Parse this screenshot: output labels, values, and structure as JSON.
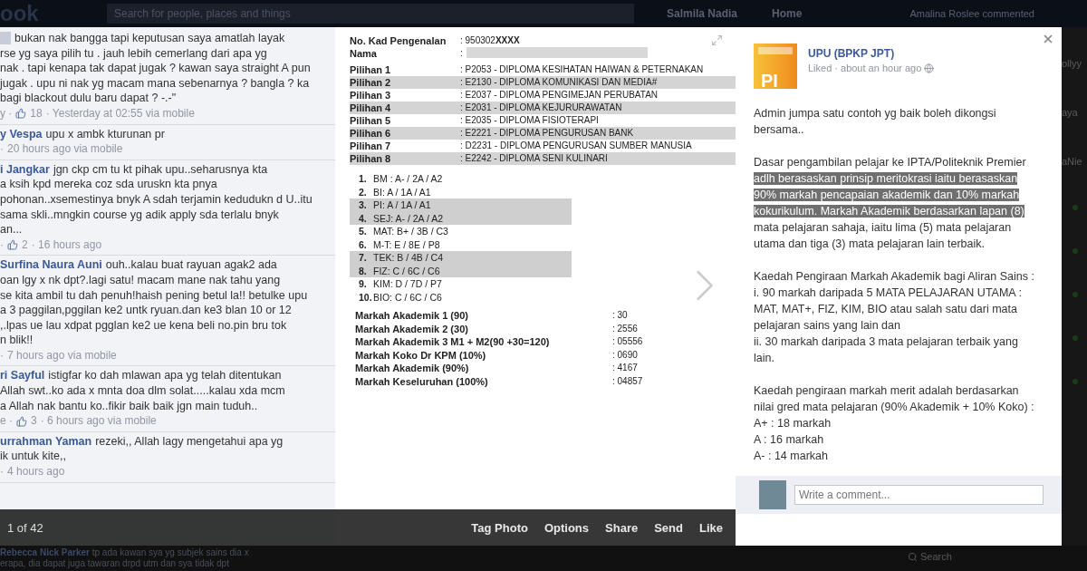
{
  "backdrop": {
    "logo": "ook",
    "search_placeholder": "Search for people, places and things",
    "user": "Salmila Nadia",
    "home": "Home",
    "ticker": "Amalina Roslee commented",
    "side_fragments": [
      "ollyy",
      "aya",
      "aNie"
    ],
    "bottom_comment": {
      "name": "Rebecca Nick Parker",
      "lines": [
        "tp ada kawan sya yg subjek sains dia x",
        "erapa, dia dapat juga tawaran drpd utm dan sya tidak dpt"
      ]
    },
    "chat_search": "Search"
  },
  "photo": {
    "comments": [
      {
        "redacted": true,
        "lines": [
          "bukan nak bangga tapi keputusan saya amatlah layak",
          "rse yg saya pilih tu . jauh lebih cemerlang dari apa yg",
          "nak . tapi kenapa tak dapat jugak ? kawan saya straight A pun",
          "jugak . upu ni nak yg macam mana sebenarnya ? bangla ? ka",
          "bagi blackout dulu baru dapat ? -.-\""
        ],
        "meta": {
          "prefix": "y ·",
          "likes": "18",
          "time": "· Yesterday at 02:55 via mobile"
        }
      },
      {
        "redacted": false,
        "name": "y Vespa",
        "lines": [
          "upu x ambk kturunan pr"
        ],
        "meta": {
          "prefix": "·",
          "time": "20 hours ago via mobile"
        }
      },
      {
        "redacted": false,
        "name": "i Jangkar",
        "lines": [
          "jgn ckp cm tu kt pihak upu..seharusnya kta",
          "a ksih kpd mereka coz sda uruskn kta pnya",
          "pohonan..xsemestinya bnyk A sdah terjamin kedudukn d U..itu",
          "sama skli..mngkin course yg adik apply sda terlalu bnyk",
          "an..."
        ],
        "meta": {
          "prefix": "·",
          "likes": "2",
          "time": "· 16 hours ago"
        }
      },
      {
        "redacted": false,
        "name": "Surfina Naura Auni",
        "lines": [
          "ouh..kalau buat rayuan agak2 ada",
          "oan lgy x nk dpt?.lagi satu! macam mane nak tahu yang",
          "se kita ambil tu dah penuh!haish pening betul la!! betulke upu",
          "a 3 paggilan,pggilan ke2 untk ryuan.dan ke3 blan 10 or 12",
          ",.lpas ue lau xdpat pgglan ke2 ue kena beli no.pin bru tok",
          "n blik!!"
        ],
        "meta": {
          "prefix": "·",
          "time": "7 hours ago via mobile"
        }
      },
      {
        "redacted": false,
        "name": "ri Sayful",
        "lines": [
          "istigfar ko dah mlawan apa yg telah ditentukan",
          "Allah swt..ko ada x mnta doa dlm solat.....kalau xda mcm",
          "a Allah nak bantu ko..fikir baik baik jgn main tuduh.."
        ],
        "meta": {
          "prefix": "e ·",
          "likes": "3",
          "time": "· 6 hours ago via mobile"
        }
      },
      {
        "redacted": false,
        "name": "urrahman Yaman",
        "lines": [
          "rezeki,, Allah lagy mengetahui apa yg",
          "ik untuk kite,,"
        ],
        "meta": {
          "prefix": "·",
          "time": "4 hours ago"
        }
      }
    ],
    "slip": {
      "id": {
        "label": "No. Kad Pengenalan",
        "value": ": 950302**XXXX**"
      },
      "name": {
        "label": "Nama",
        "value": ":",
        "redacted": true
      },
      "choices": [
        {
          "label": "Pilihan 1",
          "value": ": P2053 - DIPLOMA KESIHATAN HAIWAN & PETERNAKAN",
          "shaded": false
        },
        {
          "label": "Pilihan 2",
          "value": ": E2130 - DIPLOMA KOMUNIKASI DAN MEDIA#",
          "shaded": true
        },
        {
          "label": "Pilihan 3",
          "value": ": E2037 - DIPLOMA PENGIMEJAN PERUBATAN",
          "shaded": false
        },
        {
          "label": "Pilihan 4",
          "value": ": E2031 - DIPLOMA KEJURURAWATAN",
          "shaded": true
        },
        {
          "label": "Pilihan 5",
          "value": ": E2035 - DIPLOMA FISIOTERAPI",
          "shaded": false
        },
        {
          "label": "Pilihan 6",
          "value": ": E2221 - DIPLOMA PENGURUSAN BANK",
          "shaded": true
        },
        {
          "label": "Pilihan 7",
          "value": ": D2231 - DIPLOMA PENGURUSAN SUMBER MANUSIA",
          "shaded": false
        },
        {
          "label": "Pilihan 8",
          "value": ": E2242 - DIPLOMA SENI KULINARI",
          "shaded": true
        }
      ],
      "subjects": [
        {
          "num": "1.",
          "text": "BM : A- / 2A / A2",
          "shaded": false
        },
        {
          "num": "2.",
          "text": "BI: A / 1A / A1",
          "shaded": false
        },
        {
          "num": "3.",
          "text": "PI: A / 1A / A1",
          "shaded": true
        },
        {
          "num": "4.",
          "text": "SEJ: A- / 2A / A2",
          "shaded": true
        },
        {
          "num": "5.",
          "text": "MAT: B+ / 3B / C3",
          "shaded": false
        },
        {
          "num": "6.",
          "text": "M-T: E / 8E / P8",
          "shaded": false
        },
        {
          "num": "7.",
          "text": "TEK: B / 4B / C4",
          "shaded": true
        },
        {
          "num": "8.",
          "text": "FIZ: C / 6C / C6",
          "shaded": true
        },
        {
          "num": "9.",
          "text": "KIM: D / 7D / P7",
          "shaded": false
        },
        {
          "num": "10.",
          "text": "BIO: C / 6C / C6",
          "shaded": false
        }
      ],
      "marks": [
        {
          "label": "Markah Akademik 1 (90)",
          "value": ": 30"
        },
        {
          "label": "Markah Akademik 2 (30)",
          "value": ": 2556"
        },
        {
          "label": "Markah Akademik 3 M1 + M2(90 +30=120)",
          "value": ": 05556"
        },
        {
          "label": "Markah Koko Dr KPM (10%)",
          "value": ": 0690"
        },
        {
          "label": "Markah Akademik (90%)",
          "value": ": 4167"
        },
        {
          "label": "Markah Keseluruhan (100%)",
          "value": ": 04857"
        }
      ]
    },
    "counter": "1 of 42",
    "actions": [
      "Tag Photo",
      "Options",
      "Share",
      "Send",
      "Like"
    ]
  },
  "post": {
    "logo_text": "PI",
    "name": "UPU (BPKP JPT)",
    "liked": "Liked",
    "time": "· about an hour ago",
    "paragraphs": [
      {
        "kind": "lines",
        "lines": [
          "Admin jumpa satu contoh yg baik boleh dikongsi bersama.."
        ]
      },
      {
        "kind": "selection",
        "segments": [
          {
            "text": "Dasar pengambilan pelajar ke IPTA/Politeknik Premier ",
            "selected": false
          },
          {
            "text": "adlh berasaskan prinsip meritokrasi iaitu berasaskan 90% markah pencapaian akademik dan 10% markah kokurikulum. Markah Akademik berdasarkan lapan (8)",
            "selected": true
          },
          {
            "text": " mata pelajaran sahaja, iaitu lima (5) mata pelajaran utama dan tiga (3) mata pelajaran lain terbaik.",
            "selected": false
          }
        ]
      },
      {
        "kind": "lines",
        "lines": [
          "Kaedah Pengiraan Markah Akademik bagi Aliran Sains :",
          "i. 90 markah daripada 5 MATA PELAJARAN UTAMA : MAT, MAT+, FIZ, KIM, BIO atau salah satu dari mata pelajaran sains yang lain dan",
          "ii. 30 markah daripada 3 mata pelajaran terbaik yang lain."
        ]
      },
      {
        "kind": "lines",
        "lines": [
          "Kaedah pengiraan markah merit adalah berdasarkan nilai gred mata pelajaran (90% Akademik + 10% Koko) :",
          "A+ : 18 markah",
          "A : 16 markah",
          "A- : 14 markah"
        ]
      }
    ],
    "comment_placeholder": "Write a comment..."
  }
}
